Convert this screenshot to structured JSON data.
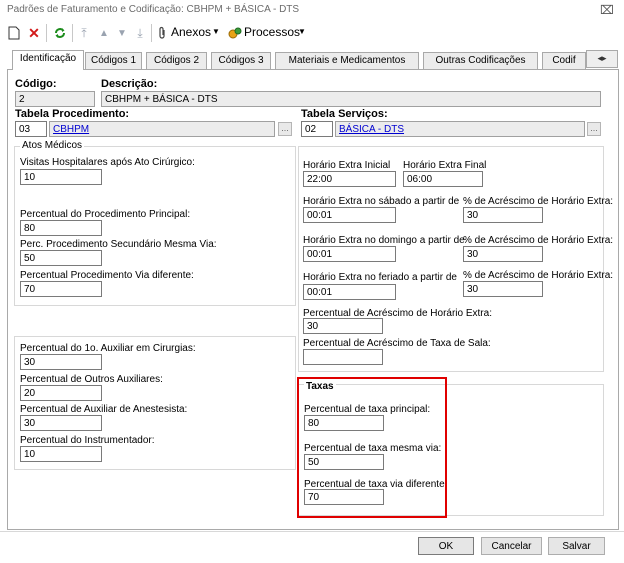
{
  "window": {
    "title": "Padrões de Faturamento e Codificação: CBHPM + BÁSICA - DTS",
    "close_glyph": "⌧"
  },
  "toolbar": {
    "anexos_label": "Anexos",
    "processos_label": "Processos"
  },
  "tabs": [
    "Identificação",
    "Códigos 1",
    "Códigos 2",
    "Códigos 3",
    "Materiais e Medicamentos",
    "Outras Codificações",
    "Codif"
  ],
  "header": {
    "codigo_label": "Código:",
    "codigo_value": "2",
    "descricao_label": "Descrição:",
    "descricao_value": "CBHPM + BÁSICA - DTS",
    "tabela_proc_label": "Tabela Procedimento:",
    "tabela_proc_code": "03",
    "tabela_proc_name": "CBHPM",
    "tabela_serv_label": "Tabela Serviços:",
    "tabela_serv_code": "02",
    "tabela_serv_name": "BÁSICA - DTS"
  },
  "atos": {
    "group_title": "Atos Médicos",
    "visitas_label": "Visitas Hospitalares após Ato Cirúrgico:",
    "visitas_value": "10",
    "perc_principal_label": "Percentual do Procedimento Principal:",
    "perc_principal_value": "80",
    "perc_secundario_label": "Perc. Procedimento Secundário Mesma Via:",
    "perc_secundario_value": "50",
    "perc_via_dif_label": "Percentual Procedimento Via diferente:",
    "perc_via_dif_value": "70"
  },
  "auxiliares": {
    "aux1_label": "Percentual do 1o. Auxiliar em Cirurgias:",
    "aux1_value": "30",
    "outros_label": "Percentual de Outros Auxiliares:",
    "outros_value": "20",
    "anest_label": "Percentual de Auxiliar de Anestesista:",
    "anest_value": "30",
    "instr_label": "Percentual do Instrumentador:",
    "instr_value": "10"
  },
  "horario": {
    "inicial_label": "Horário Extra Inicial",
    "inicial_value": "22:00",
    "final_label": "Horário Extra Final",
    "final_value": "06:00",
    "sabado_label": "Horário Extra no sábado a partir de",
    "sabado_value": "00:01",
    "sabado_perc_label": "% de Acréscimo de Horário Extra:",
    "sabado_perc_value": "30",
    "domingo_label": "Horário Extra no domingo a partir de",
    "domingo_value": "00:01",
    "domingo_perc_label": "% de Acréscimo de Horário Extra:",
    "domingo_perc_value": "30",
    "feriado_label": "Horário Extra no feriado a partir de",
    "feriado_value": "00:01",
    "feriado_perc_label": "% de Acréscimo de Horário Extra:",
    "feriado_perc_value": "30",
    "acrescimo_label": "Percentual de Acréscimo de Horário Extra:",
    "acrescimo_value": "30",
    "sala_label": "Percentual de Acréscimo de Taxa de Sala:",
    "sala_value": ""
  },
  "taxas": {
    "group_title": "Taxas",
    "principal_label": "Percentual de taxa principal:",
    "principal_value": "80",
    "mesma_via_label": "Percentual de taxa mesma via:",
    "mesma_via_value": "50",
    "via_dif_label": "Percentual de taxa via diferente:",
    "via_dif_value": "70"
  },
  "buttons": {
    "ok": "OK",
    "cancelar": "Cancelar",
    "salvar": "Salvar"
  },
  "colors": {
    "highlight": "#e00000",
    "link": "#0000d0"
  }
}
